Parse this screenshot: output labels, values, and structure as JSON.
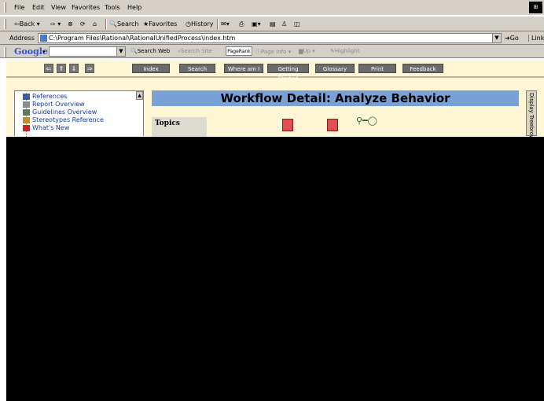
{
  "menu": {
    "items": [
      "File",
      "Edit",
      "View",
      "Favorites",
      "Tools",
      "Help"
    ]
  },
  "toolbar": {
    "back": "Back",
    "search": "Search",
    "favorites": "Favorites",
    "history": "History"
  },
  "address": {
    "label": "Address",
    "url": "C:\\Program Files\\Rational\\RationalUnifiedProcess\\index.htm",
    "go": "Go",
    "links": "Links"
  },
  "google": {
    "logo": "Google",
    "search_web": "Search Web",
    "search_site": "Search Site",
    "pagerank": "PageRank",
    "page_info": "Page Info",
    "up": "Up",
    "highlight": "Highlight"
  },
  "nav": {
    "buttons": [
      "Index",
      "Search",
      "Where am I",
      "Getting Started",
      "Glossary",
      "Print",
      "Feedback"
    ]
  },
  "tree": {
    "items": [
      "References",
      "Report Overview",
      "Guidelines Overview",
      "Stereotypes Reference",
      "What's New"
    ]
  },
  "content": {
    "title": "Workflow Detail:  Analyze Behavior",
    "topics": "Topics",
    "side_tab": "Display Treebrowser"
  }
}
